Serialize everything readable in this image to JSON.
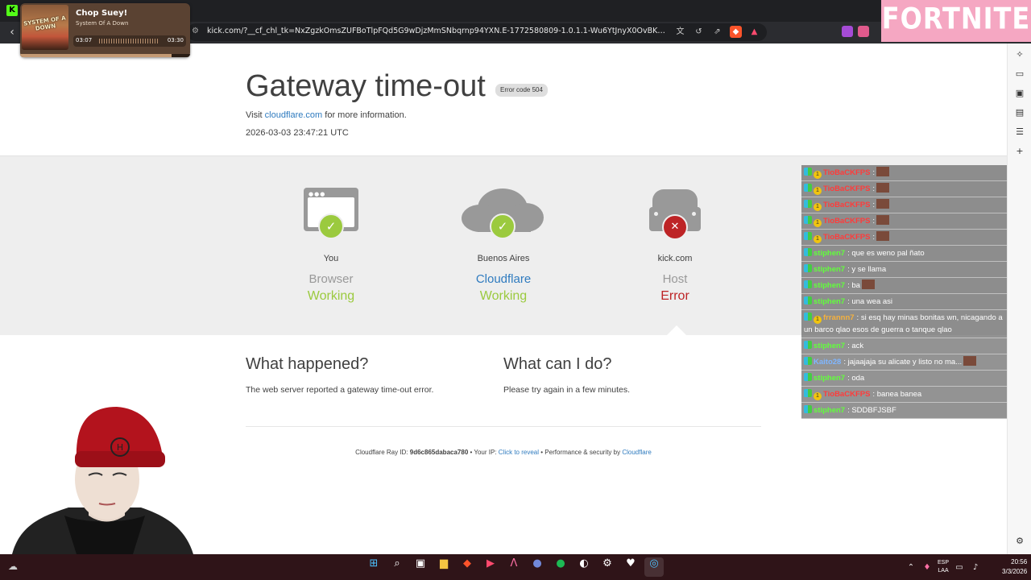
{
  "browser": {
    "url": "kick.com/?__cf_chl_tk=NxZgzkOmsZUFBoTlpFQd5G9wDjzMmSNbqrnp94YXN.E-1772580809-1.0.1.1-Wu6YtJnyX0OvBK6GsSEjbyDKP.2idZa...",
    "tab_favicon": "kick-icon"
  },
  "overlay": {
    "game_logo": "FORTNITE"
  },
  "music": {
    "title": "Chop Suey!",
    "artist": "System Of A Down",
    "album_art_text": "SYSTEM OF A DOWN",
    "current": "03:07",
    "total": "03:30",
    "progress_fraction": 0.89
  },
  "page": {
    "title": "Gateway time-out",
    "error_code": "Error code 504",
    "visit_prefix": "Visit",
    "visit_link": "cloudflare.com",
    "visit_suffix": "for more information.",
    "timestamp": "2026-03-03 23:47:21 UTC",
    "nodes": [
      {
        "location": "You",
        "kind": "Browser",
        "status": "Working"
      },
      {
        "location": "Buenos Aires",
        "kind": "Cloudflare",
        "status": "Working"
      },
      {
        "location": "kick.com",
        "kind": "Host",
        "status": "Error"
      }
    ],
    "what_happened": {
      "heading": "What happened?",
      "body": "The web server reported a gateway time-out error."
    },
    "what_can_i_do": {
      "heading": "What can I do?",
      "body": "Please try again in a few minutes."
    },
    "footer": {
      "ray_label": "Cloudflare Ray ID:",
      "ray_id": "9d6c865dabaca780",
      "ip_label": "• Your IP:",
      "ip_link": "Click to reveal",
      "perf_label": "• Performance & security by",
      "perf_link": "Cloudflare"
    }
  },
  "chat": [
    {
      "user": "TioBaCKFPS",
      "text": ":",
      "style": "red"
    },
    {
      "user": "TioBaCKFPS",
      "text": ":",
      "style": "red"
    },
    {
      "user": "TioBaCKFPS",
      "text": ":",
      "style": "red"
    },
    {
      "user": "TioBaCKFPS",
      "text": ":",
      "style": "red"
    },
    {
      "user": "TioBaCKFPS",
      "text": ":",
      "style": "red"
    },
    {
      "user": "stiphen7",
      "text": ": que es weno pal ñato",
      "style": "green"
    },
    {
      "user": "stiphen7",
      "text": ": y se llama",
      "style": "green"
    },
    {
      "user": "stiphen7",
      "text": ": ba",
      "style": "green"
    },
    {
      "user": "stiphen7",
      "text": ": una wea asi",
      "style": "green"
    },
    {
      "user": "frrannn7",
      "text": ": si esq hay minas bonitas wn, nicagando a un barco qlao esos de guerra o tanque qlao",
      "style": "orange"
    },
    {
      "user": "stiphen7",
      "text": ": ack",
      "style": "green"
    },
    {
      "user": "Kaito28",
      "text": ": jajaajaja su alicate y listo no ma...",
      "style": "blue"
    },
    {
      "user": "stiphen7",
      "text": ": oda",
      "style": "green"
    },
    {
      "user": "TioBaCKFPS",
      "text": ": banea banea",
      "style": "red"
    },
    {
      "user": "stiphen7",
      "text": ": SDDBFJSBF",
      "style": "green"
    }
  ],
  "taskbar": {
    "lang_top": "ESP",
    "lang_bottom": "LAA",
    "time": "20:56",
    "date": "3/3/2026"
  },
  "colors": {
    "ok": "#9bca3e",
    "error": "#bd2426",
    "link": "#2f7bbf"
  }
}
